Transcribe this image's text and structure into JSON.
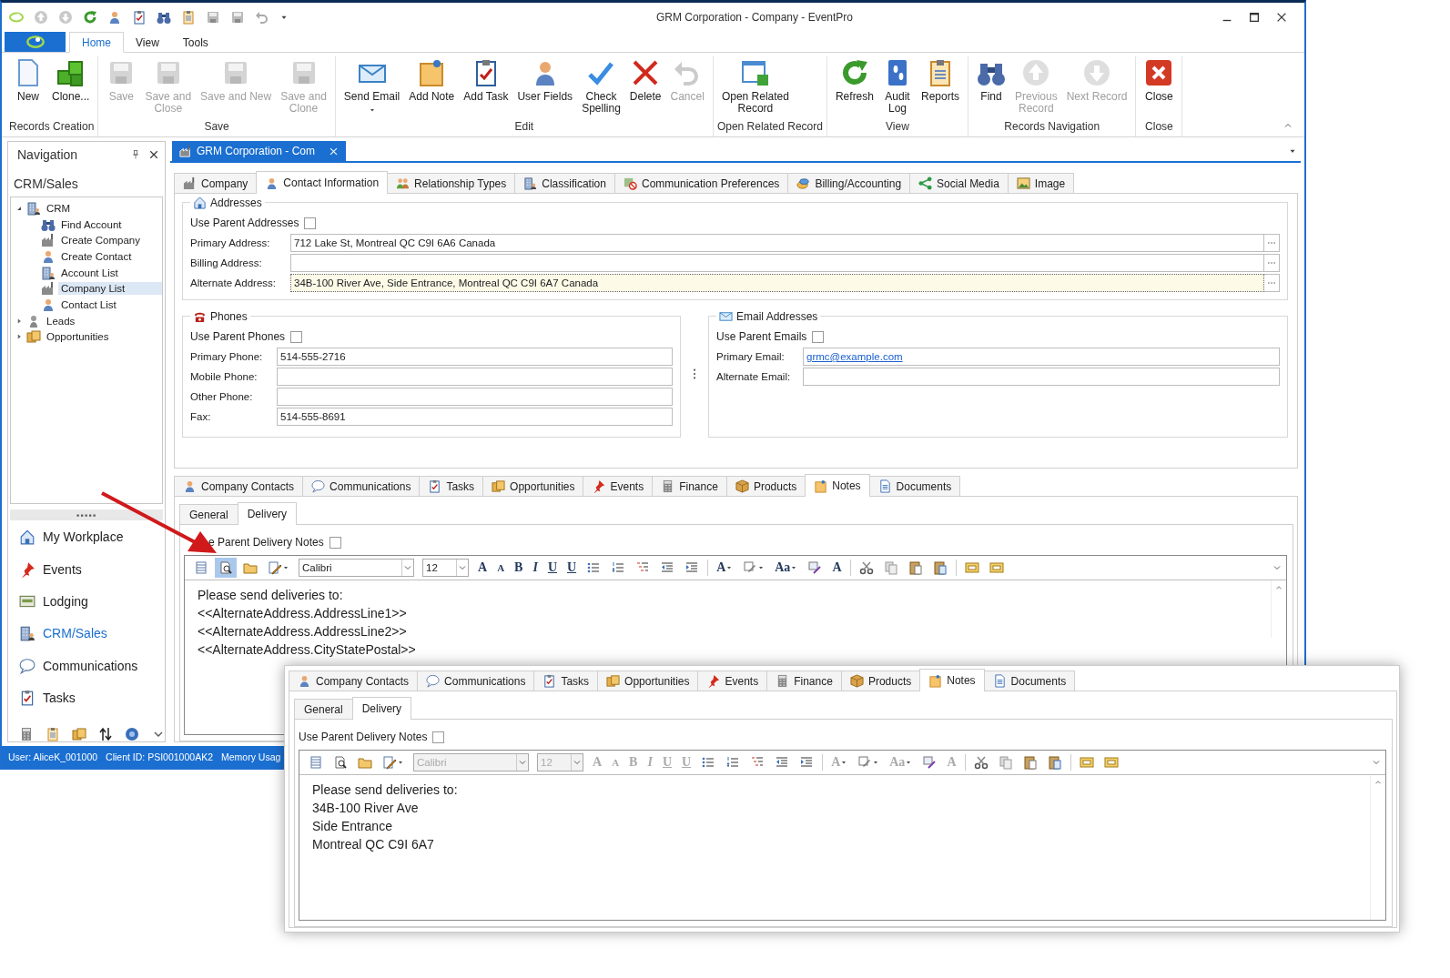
{
  "title_bar": {
    "title": "GRM Corporation - Company - EventPro"
  },
  "ribbon_tabs": [
    {
      "label": "Home",
      "selected": true
    },
    {
      "label": "View",
      "selected": false
    },
    {
      "label": "Tools",
      "selected": false
    }
  ],
  "ribbon_groups": [
    {
      "label": "Records Creation",
      "buttons": [
        {
          "label": "New",
          "disabled": false
        },
        {
          "label": "Clone...",
          "disabled": false
        }
      ]
    },
    {
      "label": "Save",
      "buttons": [
        {
          "label": "Save",
          "disabled": true
        },
        {
          "label": "Save and\nClose",
          "disabled": true
        },
        {
          "label": "Save and New",
          "disabled": true
        },
        {
          "label": "Save and\nClone",
          "disabled": true
        }
      ]
    },
    {
      "label": "Edit",
      "buttons": [
        {
          "label": "Send Email",
          "disabled": false,
          "dropdown": true
        },
        {
          "label": "Add Note",
          "disabled": false
        },
        {
          "label": "Add Task",
          "disabled": false
        },
        {
          "label": "User Fields",
          "disabled": false
        },
        {
          "label": "Check\nSpelling",
          "disabled": false
        },
        {
          "label": "Delete",
          "disabled": false
        },
        {
          "label": "Cancel",
          "disabled": true
        }
      ]
    },
    {
      "label": "Open Related Record",
      "buttons": [
        {
          "label": "Open Related\nRecord",
          "disabled": false
        }
      ]
    },
    {
      "label": "View",
      "buttons": [
        {
          "label": "Refresh",
          "disabled": false
        },
        {
          "label": "Audit\nLog",
          "disabled": false
        },
        {
          "label": "Reports",
          "disabled": false
        }
      ]
    },
    {
      "label": "Records Navigation",
      "buttons": [
        {
          "label": "Find",
          "disabled": false
        },
        {
          "label": "Previous\nRecord",
          "disabled": true
        },
        {
          "label": "Next Record",
          "disabled": true
        }
      ]
    },
    {
      "label": "Close",
      "buttons": [
        {
          "label": "Close",
          "disabled": false
        }
      ]
    }
  ],
  "navigation": {
    "title": "Navigation",
    "section": "CRM/Sales",
    "tree": [
      {
        "label": "CRM",
        "expanded": true,
        "selected": false,
        "children": [
          {
            "label": "Find Account",
            "selected": false
          },
          {
            "label": "Create Company",
            "selected": false
          },
          {
            "label": "Create Contact",
            "selected": false
          },
          {
            "label": "Account List",
            "selected": false
          },
          {
            "label": "Company List",
            "selected": true
          },
          {
            "label": "Contact List",
            "selected": false
          }
        ]
      },
      {
        "label": "Leads",
        "expanded": false,
        "selected": false
      },
      {
        "label": "Opportunities",
        "expanded": false,
        "selected": false
      }
    ],
    "buttons": [
      {
        "label": "My Workplace",
        "selected": false
      },
      {
        "label": "Events",
        "selected": false
      },
      {
        "label": "Lodging",
        "selected": false
      },
      {
        "label": "CRM/Sales",
        "selected": true
      },
      {
        "label": "Communications",
        "selected": false
      },
      {
        "label": "Tasks",
        "selected": false
      }
    ]
  },
  "document_tab": {
    "label": "GRM Corporation - Com"
  },
  "record_tabs": [
    {
      "label": "Company",
      "selected": false
    },
    {
      "label": "Contact Information",
      "selected": true
    },
    {
      "label": "Relationship Types",
      "selected": false
    },
    {
      "label": "Classification",
      "selected": false
    },
    {
      "label": "Communication Preferences",
      "selected": false
    },
    {
      "label": "Billing/Accounting",
      "selected": false
    },
    {
      "label": "Social Media",
      "selected": false
    },
    {
      "label": "Image",
      "selected": false
    }
  ],
  "addresses": {
    "title": "Addresses",
    "use_parent": {
      "label": "Use Parent Addresses",
      "checked": false
    },
    "fields": [
      {
        "label": "Primary Address:",
        "value": "712 Lake St, Montreal QC C9I 6A6 Canada",
        "focused": false
      },
      {
        "label": "Billing Address:",
        "focused": false
      },
      {
        "label": "Alternate Address:",
        "value": "34B-100 River Ave, Side Entrance, Montreal QC C9I 6A7 Canada",
        "focused": true
      }
    ]
  },
  "phones": {
    "title": "Phones",
    "use_parent": {
      "label": "Use Parent Phones",
      "checked": false
    },
    "fields": [
      {
        "label": "Primary Phone:",
        "value": "514-555-2716"
      },
      {
        "label": "Mobile Phone:"
      },
      {
        "label": "Other Phone:"
      },
      {
        "label": "Fax:",
        "value": "514-555-8691"
      }
    ]
  },
  "emails": {
    "title": "Email Addresses",
    "use_parent": {
      "label": "Use Parent Emails",
      "checked": false
    },
    "fields": [
      {
        "label": "Primary Email:",
        "value": "grmc@example.com"
      },
      {
        "label": "Alternate Email:"
      }
    ]
  },
  "notes": {
    "tabs": [
      {
        "label": "Company Contacts",
        "selected": false
      },
      {
        "label": "Communications",
        "selected": false
      },
      {
        "label": "Tasks",
        "selected": false
      },
      {
        "label": "Opportunities",
        "selected": false
      },
      {
        "label": "Events",
        "selected": false
      },
      {
        "label": "Finance",
        "selected": false
      },
      {
        "label": "Products",
        "selected": false
      },
      {
        "label": "Notes",
        "selected": true
      },
      {
        "label": "Documents",
        "selected": false
      }
    ],
    "subtabs": [
      {
        "label": "General",
        "selected": false
      },
      {
        "label": "Delivery",
        "selected": true
      }
    ],
    "use_parent": {
      "label": "e Parent Delivery Notes",
      "checked": false
    },
    "toolbar": [
      {
        "kind": "icon",
        "pressed": false
      },
      {
        "kind": "icon",
        "pressed": true
      },
      {
        "kind": "icon",
        "pressed": false
      },
      {
        "kind": "icon",
        "pressed": false,
        "dropdown": true
      },
      {
        "kind": "font",
        "value": "Calibri",
        "disabled": false
      },
      {
        "kind": "size",
        "value": "12",
        "disabled": false
      },
      {
        "kind": "glyph",
        "text": "A",
        "disabled": false
      },
      {
        "kind": "glyph",
        "text": "A",
        "disabled": false
      },
      {
        "kind": "glyph",
        "text": "B",
        "disabled": false
      },
      {
        "kind": "glyph",
        "text": "I",
        "disabled": false
      },
      {
        "kind": "glyph",
        "text": "U",
        "disabled": false
      },
      {
        "kind": "glyph",
        "text": "U",
        "disabled": false
      },
      {
        "kind": "icon",
        "pressed": false
      },
      {
        "kind": "icon",
        "pressed": false
      },
      {
        "kind": "icon",
        "pressed": false
      },
      {
        "kind": "icon",
        "pressed": false
      },
      {
        "kind": "icon",
        "pressed": false
      },
      {
        "kind": "separator"
      },
      {
        "kind": "glyph",
        "text": "A",
        "disabled": false,
        "dropdown": true
      },
      {
        "kind": "icon",
        "pressed": false,
        "dropdown": true
      },
      {
        "kind": "glyph",
        "text": "Aa",
        "disabled": false,
        "dropdown": true
      },
      {
        "kind": "icon",
        "pressed": false
      },
      {
        "kind": "glyph",
        "text": "A",
        "disabled": false
      },
      {
        "kind": "separator"
      },
      {
        "kind": "icon",
        "pressed": false
      },
      {
        "kind": "icon",
        "pressed": false
      },
      {
        "kind": "icon",
        "pressed": false
      },
      {
        "kind": "icon",
        "pressed": false
      },
      {
        "kind": "separator"
      },
      {
        "kind": "icon",
        "pressed": false
      },
      {
        "kind": "icon",
        "pressed": false
      }
    ],
    "lines": [
      "Please send deliveries to:",
      "<<AlternateAddress.AddressLine1>>",
      "<<AlternateAddress.AddressLine2>>",
      "<<AlternateAddress.CityStatePostal>>"
    ]
  },
  "status_bar": {
    "items": [
      "User: AliceK_001000",
      "Client ID: PSI001000AK2",
      "Memory Usag"
    ]
  },
  "callout": {
    "tabs": [
      {
        "label": "Company Contacts",
        "selected": false
      },
      {
        "label": "Communications",
        "selected": false
      },
      {
        "label": "Tasks",
        "selected": false
      },
      {
        "label": "Opportunities",
        "selected": false
      },
      {
        "label": "Events",
        "selected": false
      },
      {
        "label": "Finance",
        "selected": false
      },
      {
        "label": "Products",
        "selected": false
      },
      {
        "label": "Notes",
        "selected": true
      },
      {
        "label": "Documents",
        "selected": false
      }
    ],
    "subtabs": [
      {
        "label": "General",
        "selected": false
      },
      {
        "label": "Delivery",
        "selected": true
      }
    ],
    "use_parent": {
      "label": "Use Parent Delivery Notes",
      "checked": false
    },
    "toolbar": [
      {
        "kind": "icon",
        "pressed": false
      },
      {
        "kind": "icon",
        "pressed": false
      },
      {
        "kind": "icon",
        "pressed": false
      },
      {
        "kind": "icon",
        "pressed": false,
        "dropdown": true
      },
      {
        "kind": "font",
        "value": "Calibri",
        "disabled": true
      },
      {
        "kind": "size",
        "value": "12",
        "disabled": true
      },
      {
        "kind": "glyph",
        "text": "A",
        "disabled": true
      },
      {
        "kind": "glyph",
        "text": "A",
        "disabled": true
      },
      {
        "kind": "glyph",
        "text": "B",
        "disabled": true
      },
      {
        "kind": "glyph",
        "text": "I",
        "disabled": true
      },
      {
        "kind": "glyph",
        "text": "U",
        "disabled": true
      },
      {
        "kind": "glyph",
        "text": "U",
        "disabled": true
      },
      {
        "kind": "icon",
        "pressed": false
      },
      {
        "kind": "icon",
        "pressed": false
      },
      {
        "kind": "icon",
        "pressed": false
      },
      {
        "kind": "icon",
        "pressed": false
      },
      {
        "kind": "icon",
        "pressed": false
      },
      {
        "kind": "separator"
      },
      {
        "kind": "glyph",
        "text": "A",
        "disabled": true,
        "dropdown": true
      },
      {
        "kind": "icon",
        "pressed": false,
        "dropdown": true
      },
      {
        "kind": "glyph",
        "text": "Aa",
        "disabled": true,
        "dropdown": true
      },
      {
        "kind": "icon",
        "pressed": false
      },
      {
        "kind": "glyph",
        "text": "A",
        "disabled": true
      },
      {
        "kind": "separator"
      },
      {
        "kind": "icon",
        "pressed": false
      },
      {
        "kind": "icon",
        "pressed": false
      },
      {
        "kind": "icon",
        "pressed": false
      },
      {
        "kind": "icon",
        "pressed": false
      },
      {
        "kind": "separator"
      },
      {
        "kind": "icon",
        "pressed": false
      },
      {
        "kind": "icon",
        "pressed": false
      }
    ],
    "lines": [
      "Please send deliveries to:",
      "34B-100 River Ave",
      "Side Entrance",
      "Montreal QC C9I 6A7"
    ]
  }
}
